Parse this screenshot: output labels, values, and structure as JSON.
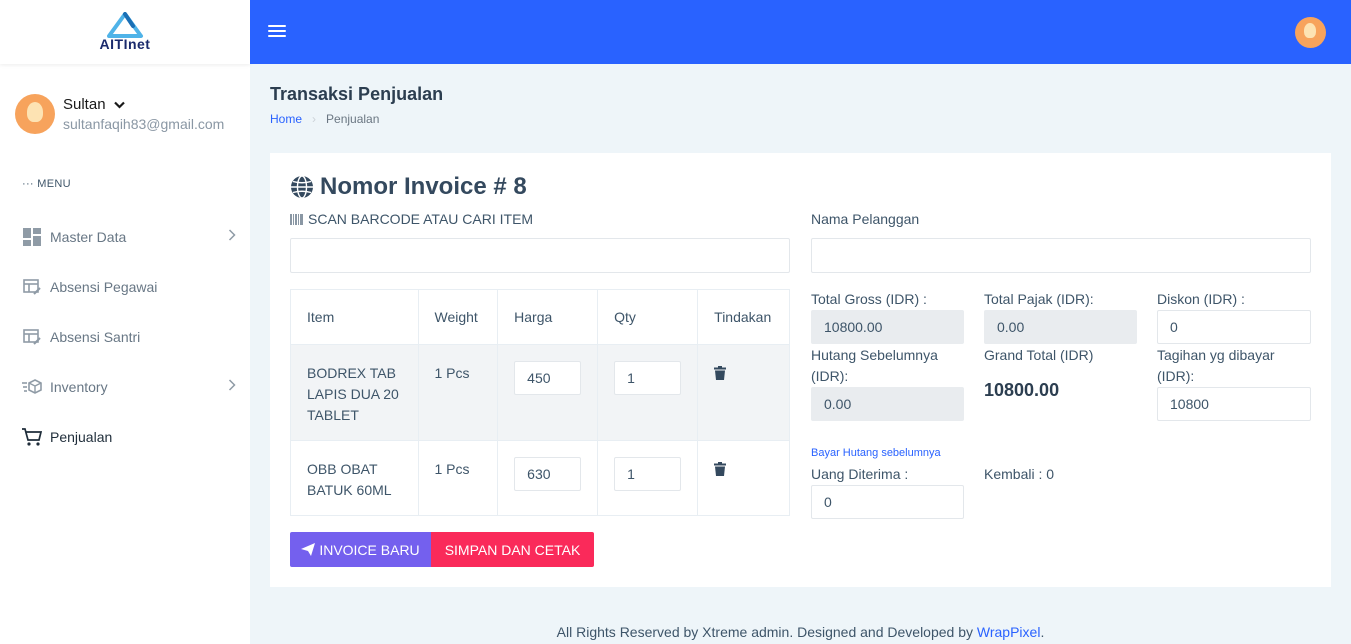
{
  "logo": {
    "text": "AITInet",
    "icon": "logo-triangle-icon"
  },
  "user": {
    "name": "Sultan",
    "email": "sultanfaqih83@gmail.com"
  },
  "sidebar": {
    "menu_label": "MENU",
    "items": [
      {
        "label": "Master Data",
        "icon": "dashboard-grid-icon",
        "has_children": true
      },
      {
        "label": "Absensi Pegawai",
        "icon": "table-edit-icon",
        "has_children": false
      },
      {
        "label": "Absensi Santri",
        "icon": "table-edit-icon",
        "has_children": false
      },
      {
        "label": "Inventory",
        "icon": "box-list-icon",
        "has_children": true
      },
      {
        "label": "Penjualan",
        "icon": "cart-icon",
        "has_children": false
      }
    ]
  },
  "page": {
    "title": "Transaksi Penjualan"
  },
  "breadcrumb": {
    "home": "Home",
    "current": "Penjualan"
  },
  "invoice": {
    "title": "Nomor Invoice # 8",
    "scan_label": "SCAN BARCODE ATAU CARI ITEM",
    "scan_value": "",
    "customer_label": "Nama Pelanggan",
    "customer_value": ""
  },
  "table": {
    "headers": {
      "item": "Item",
      "weight": "Weight",
      "harga": "Harga",
      "qty": "Qty",
      "tindakan": "Tindakan"
    },
    "rows": [
      {
        "item": "BODREX TAB LAPIS DUA 20 TABLET",
        "weight": "1 Pcs",
        "harga": "450",
        "qty": "1"
      },
      {
        "item": "OBB OBAT BATUK 60ML",
        "weight": "1 Pcs",
        "harga": "630",
        "qty": "1"
      }
    ]
  },
  "buttons": {
    "new_invoice": "INVOICE BARU",
    "save_print": "SIMPAN DAN CETAK"
  },
  "summary": {
    "total_gross_label": "Total Gross (IDR) :",
    "total_gross": "10800.00",
    "total_pajak_label": "Total Pajak (IDR):",
    "total_pajak": "0.00",
    "diskon_label": "Diskon (IDR) :",
    "diskon": "0",
    "hutang_label": "Hutang Sebelumnya (IDR):",
    "hutang": "0.00",
    "grand_total_label": "Grand Total (IDR)",
    "grand_total": "10800.00",
    "tagihan_label": "Tagihan yg dibayar (IDR):",
    "tagihan": "10800",
    "bayar_hutang_link": "Bayar Hutang sebelumnya",
    "uang_diterima_label": "Uang Diterima :",
    "uang_diterima": "0",
    "kembali_label": "Kembali : 0"
  },
  "footer": {
    "text": "All Rights Reserved by Xtreme admin. Designed and Developed by ",
    "link": "WrapPixel",
    "suffix": "."
  },
  "colors": {
    "topbar": "#2962ff",
    "btn_new": "#7460ee",
    "btn_save": "#fa2a5a"
  }
}
